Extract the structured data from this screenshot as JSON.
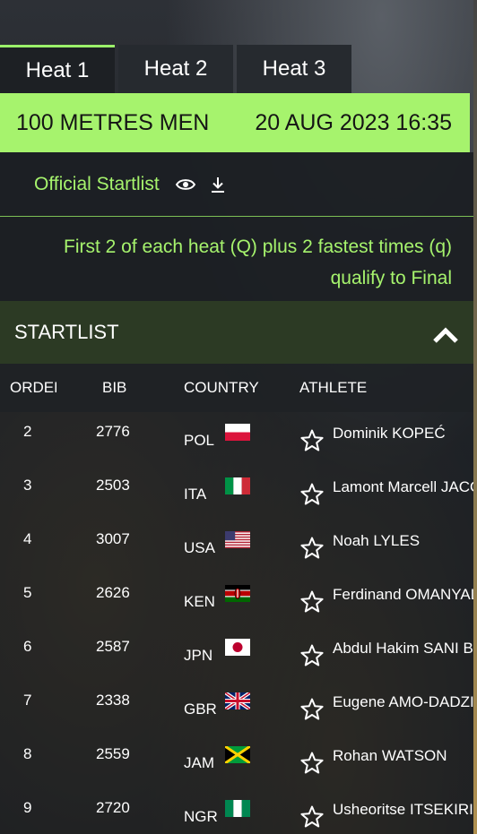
{
  "tabs": [
    {
      "label": "Heat 1",
      "active": true
    },
    {
      "label": "Heat 2",
      "active": false
    },
    {
      "label": "Heat 3",
      "active": false
    }
  ],
  "event": {
    "name": "100 METRES MEN",
    "datetime": "20 AUG 2023 16:35"
  },
  "startlist_link": {
    "label": "Official Startlist",
    "icons": [
      "eye-icon",
      "download-icon"
    ]
  },
  "qualification": {
    "line1": "First 2 of each heat (Q) plus 2 fastest times (q)",
    "line2": "qualify to Final"
  },
  "section": {
    "title": "STARTLIST",
    "icon": "chevron-up-icon"
  },
  "table": {
    "headers": {
      "order": "ORDER",
      "bib": "BIB",
      "country": "COUNTRY",
      "athlete": "ATHLETE"
    },
    "rows": [
      {
        "order": "2",
        "bib": "2776",
        "country": "POL",
        "athlete": "Dominik KOPEĆ",
        "flag": "pol-flag"
      },
      {
        "order": "3",
        "bib": "2503",
        "country": "ITA",
        "athlete": "Lamont Marcell JACOBS",
        "flag": "ita-flag"
      },
      {
        "order": "4",
        "bib": "3007",
        "country": "USA",
        "athlete": "Noah LYLES",
        "flag": "usa-flag"
      },
      {
        "order": "5",
        "bib": "2626",
        "country": "KEN",
        "athlete": "Ferdinand OMANYALA",
        "flag": "ken-flag"
      },
      {
        "order": "6",
        "bib": "2587",
        "country": "JPN",
        "athlete": "Abdul Hakim SANI BROWN",
        "flag": "jpn-flag"
      },
      {
        "order": "7",
        "bib": "2338",
        "country": "GBR",
        "athlete": "Eugene AMO-DADZIE",
        "flag": "gbr-flag"
      },
      {
        "order": "8",
        "bib": "2559",
        "country": "JAM",
        "athlete": "Rohan WATSON",
        "flag": "jam-flag"
      },
      {
        "order": "9",
        "bib": "2720",
        "country": "NGR",
        "athlete": "Usheoritse ITSEKIRI",
        "flag": "ngr-flag"
      }
    ]
  },
  "colors": {
    "accent": "#a6f36d",
    "section_bg": "#2c3a24",
    "panel_bg": "#1c1f23"
  }
}
